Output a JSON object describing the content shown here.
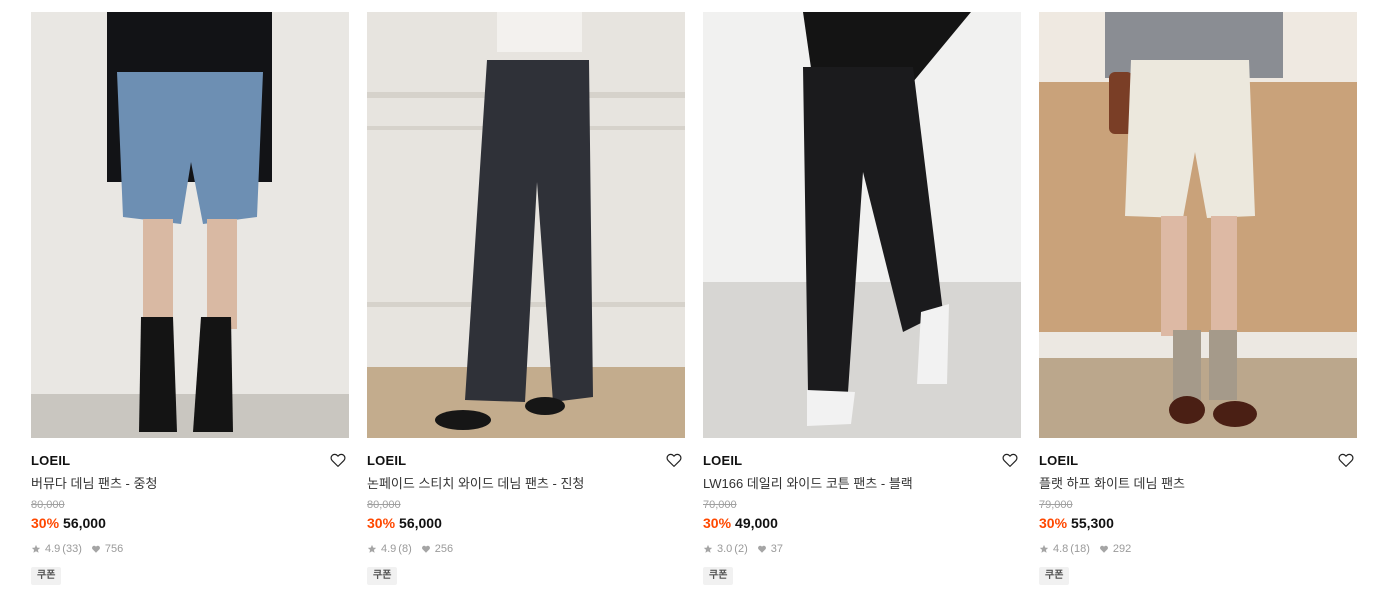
{
  "products": [
    {
      "brand": "LOEIL",
      "name": "버뮤다 데님 팬츠 - 중청",
      "original_price": "80,000",
      "discount": "30%",
      "price": "56,000",
      "rating": "4.9",
      "review_count": "(33)",
      "likes": "756",
      "coupon": "쿠폰"
    },
    {
      "brand": "LOEIL",
      "name": "논페이드 스티치 와이드 데님 팬츠 - 진청",
      "original_price": "80,000",
      "discount": "30%",
      "price": "56,000",
      "rating": "4.9",
      "review_count": "(8)",
      "likes": "256",
      "coupon": "쿠폰"
    },
    {
      "brand": "LOEIL",
      "name": "LW166 데일리 와이드 코튼 팬츠 - 블랙",
      "original_price": "70,000",
      "discount": "30%",
      "price": "49,000",
      "rating": "3.0",
      "review_count": "(2)",
      "likes": "37",
      "coupon": "쿠폰"
    },
    {
      "brand": "LOEIL",
      "name": "플랫 하프 화이트 데님 팬츠",
      "original_price": "79,000",
      "discount": "30%",
      "price": "55,300",
      "rating": "4.8",
      "review_count": "(18)",
      "likes": "292",
      "coupon": "쿠폰"
    }
  ],
  "icons": {
    "wishlist": "heart-outline-icon",
    "rating": "star-icon",
    "likes": "heart-filled-icon"
  },
  "colors": {
    "discount": "#ff4800",
    "muted": "#9a9a9a",
    "coupon_bg": "#f1f1f1"
  }
}
